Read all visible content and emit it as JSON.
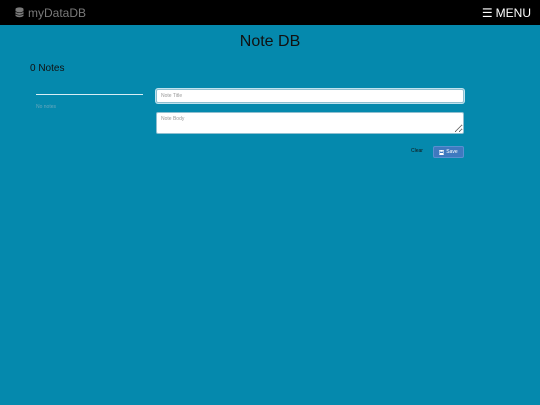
{
  "navbar": {
    "brand_icon": "database-icon",
    "brand_label": "myDataDB",
    "menu_icon": "hamburger-icon",
    "menu_label": "MENU"
  },
  "page": {
    "title": "Note DB",
    "notes_count": "0 Notes"
  },
  "sidebar": {
    "search_placeholder": "",
    "empty_message": "No notes"
  },
  "editor": {
    "title_placeholder": "Note Title",
    "title_value": "",
    "body_placeholder": "Note Body",
    "body_value": "",
    "clear_label": "Clear",
    "save_label": "Save",
    "save_icon": "floppy-disk-icon"
  },
  "colors": {
    "background": "#0589ad",
    "navbar": "#000000",
    "save_button": "#3f79bf"
  }
}
